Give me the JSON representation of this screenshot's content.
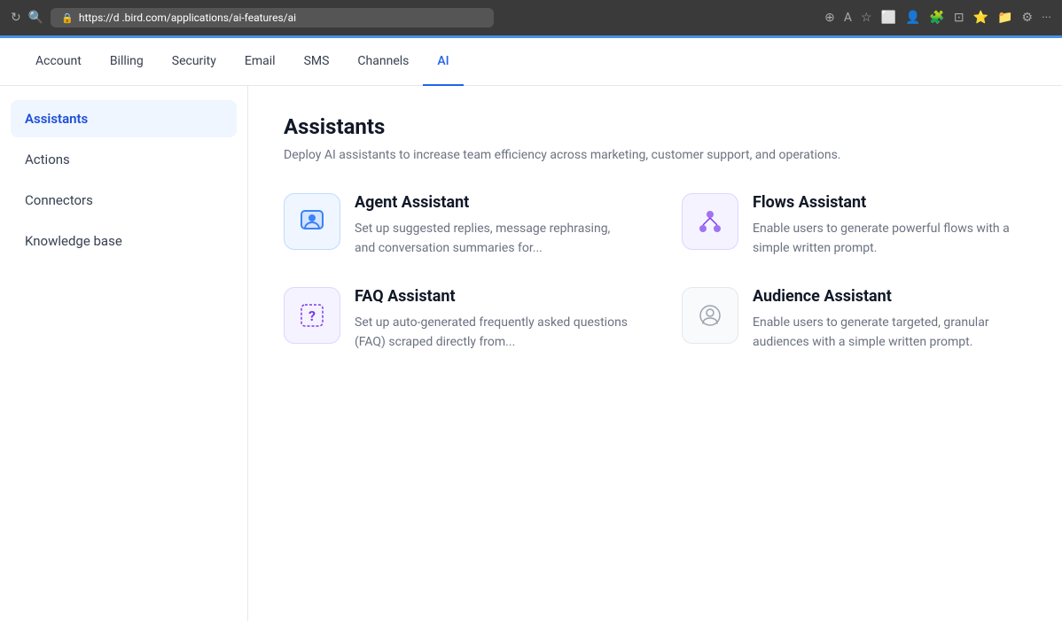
{
  "browser": {
    "url": "https://d       .bird.com/applications/ai-features/ai",
    "accent_color": "#4a90e2"
  },
  "top_nav": {
    "items": [
      {
        "label": "Account",
        "active": false
      },
      {
        "label": "Billing",
        "active": false
      },
      {
        "label": "Security",
        "active": false
      },
      {
        "label": "Email",
        "active": false
      },
      {
        "label": "SMS",
        "active": false
      },
      {
        "label": "Channels",
        "active": false
      },
      {
        "label": "AI",
        "active": true
      }
    ]
  },
  "sidebar": {
    "items": [
      {
        "label": "Assistants",
        "active": true
      },
      {
        "label": "Actions",
        "active": false
      },
      {
        "label": "Connectors",
        "active": false
      },
      {
        "label": "Knowledge base",
        "active": false
      }
    ]
  },
  "main": {
    "title": "Assistants",
    "description": "Deploy AI assistants to increase team efficiency across marketing, customer support, and operations.",
    "cards": [
      {
        "title": "Agent Assistant",
        "description": "Set up suggested replies, message rephrasing, and conversation summaries for...",
        "icon_type": "agent",
        "icon_bg": "blue-bg"
      },
      {
        "title": "Flows Assistant",
        "description": "Enable users to generate powerful flows with a simple written prompt.",
        "icon_type": "flows",
        "icon_bg": "purple-bg"
      },
      {
        "title": "FAQ Assistant",
        "description": "Set up auto-generated frequently asked questions (FAQ) scraped directly from...",
        "icon_type": "faq",
        "icon_bg": "purple-bg"
      },
      {
        "title": "Audience Assistant",
        "description": "Enable users to generate targeted, granular audiences with a simple written prompt.",
        "icon_type": "audience",
        "icon_bg": "gray-bg"
      }
    ]
  }
}
